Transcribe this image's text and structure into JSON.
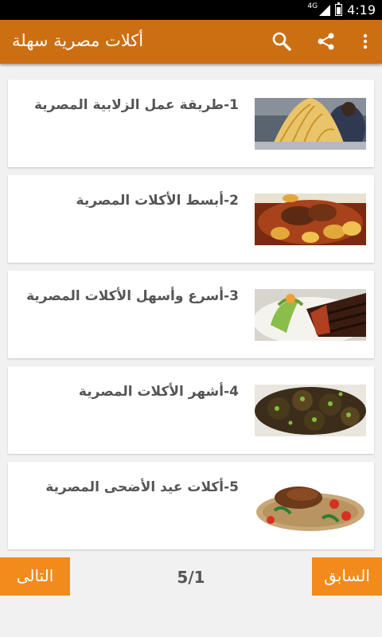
{
  "status_bar": {
    "network": "4G",
    "time": "4:19"
  },
  "app_bar": {
    "title": "أكلات مصرية سهلة",
    "icons": [
      "search-icon",
      "share-icon",
      "more-vert-icon"
    ],
    "color": "#cc6f13"
  },
  "list": {
    "items": [
      {
        "title": "1-طريقة عمل الزلابية المصرية",
        "image": "zalabia-photo"
      },
      {
        "title": "2-أبسط الأكلات المصرية",
        "image": "meat-potatoes-photo"
      },
      {
        "title": "3-أسرع وأسهل الأكلات المصرية",
        "image": "steak-salad-photo"
      },
      {
        "title": "4-أشهر الأكلات المصرية",
        "image": "stuffed-vegetables-photo"
      },
      {
        "title": "5-أكلات عيد الأضحى المصرية",
        "image": "meat-rice-platter-photo"
      }
    ]
  },
  "pagination": {
    "next_label": "التالى",
    "prev_label": "السابق",
    "page": "5/1",
    "button_color": "#f28b1c"
  }
}
